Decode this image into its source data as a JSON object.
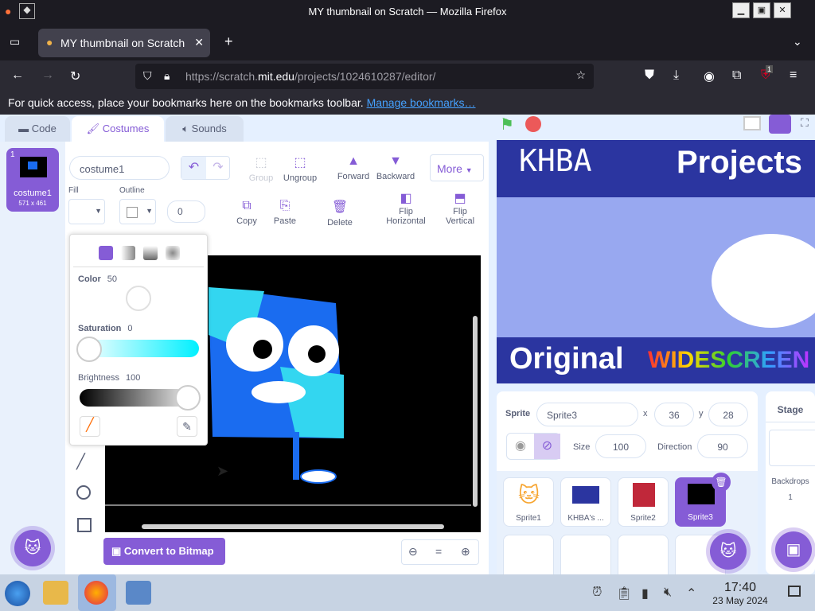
{
  "window": {
    "title": "MY thumbnail on Scratch — Mozilla Firefox"
  },
  "browser": {
    "tab_title": "MY thumbnail on Scratch",
    "url_prefix": "https://scratch.",
    "url_domain": "mit.edu",
    "url_suffix": "/projects/1024610287/editor/",
    "bookmarks_text": "For quick access, place your bookmarks here on the bookmarks toolbar.",
    "bookmarks_link": "Manage bookmarks…",
    "new_tab_icon": "+",
    "extension_badge": "1"
  },
  "editor_tabs": [
    {
      "label": "Code",
      "icon": "code-icon"
    },
    {
      "label": "Costumes",
      "icon": "brush-icon"
    },
    {
      "label": "Sounds",
      "icon": "speaker-icon"
    }
  ],
  "costume_list": [
    {
      "index": "1",
      "name": "costume1",
      "size": "571 x 461"
    }
  ],
  "paint": {
    "costume_name": "costume1",
    "fill_label": "Fill",
    "outline_label": "Outline",
    "outline_width": "0",
    "tools": {
      "group": "Group",
      "ungroup": "Ungroup",
      "forward": "Forward",
      "backward": "Backward",
      "more": "More",
      "copy": "Copy",
      "paste": "Paste",
      "delete": "Delete",
      "flip_h": "Flip Horizontal",
      "flip_v": "Flip Vertical"
    },
    "convert_button": "Convert to Bitmap",
    "zoom_reset": "="
  },
  "color_picker": {
    "color_label": "Color",
    "color_value": "50",
    "saturation_label": "Saturation",
    "saturation_value": "0",
    "brightness_label": "Brightness",
    "brightness_value": "100",
    "accent": "#855cd6"
  },
  "stage_text": {
    "top_left": "KHBA",
    "top_right": "Projects",
    "bottom_left": "Original",
    "bottom_right": "WIDESCREEN"
  },
  "sprite_info": {
    "sprite_label": "Sprite",
    "sprite_name": "Sprite3",
    "x_label": "x",
    "x_value": "36",
    "y_label": "y",
    "y_value": "28",
    "show_label": "Show",
    "size_label": "Size",
    "size_value": "100",
    "direction_label": "Direction",
    "direction_value": "90"
  },
  "sprites": [
    {
      "name": "Sprite1",
      "selected": false
    },
    {
      "name": "KHBA's ...",
      "selected": false
    },
    {
      "name": "Sprite2",
      "selected": false
    },
    {
      "name": "Sprite3",
      "selected": true
    }
  ],
  "stage_panel": {
    "title": "Stage",
    "backdrops_label": "Backdrops",
    "backdrops_count": "1"
  },
  "taskbar": {
    "time": "17:40",
    "date": "23 May 2024"
  }
}
